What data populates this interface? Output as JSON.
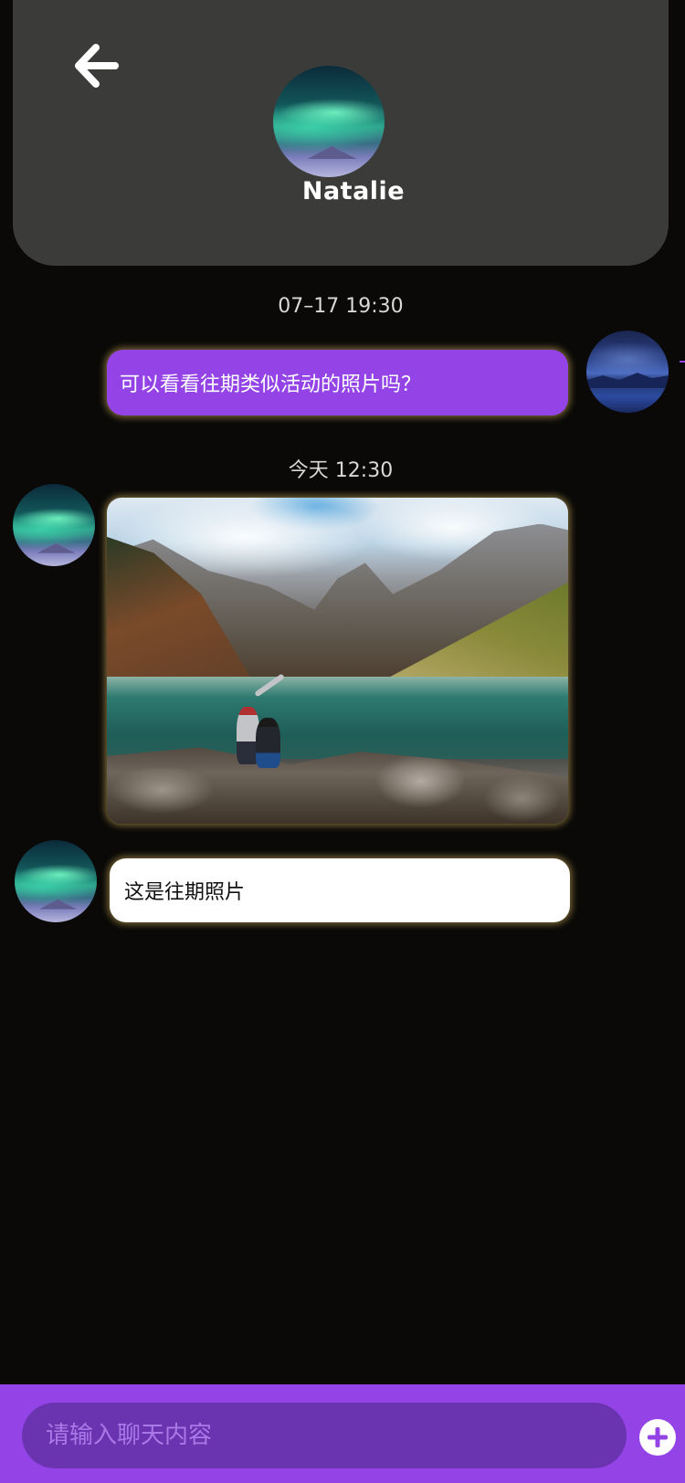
{
  "header": {
    "back_icon": "arrow-left-icon",
    "contact_name": "Natalie"
  },
  "messages": [
    {
      "timestamp": "07–17 19:30"
    },
    {
      "type": "text",
      "direction": "sent",
      "text": "可以看看往期类似活动的照片吗？"
    },
    {
      "timestamp": "今天 12:30"
    },
    {
      "type": "image",
      "direction": "received",
      "image": "mountain-lake-photo"
    },
    {
      "type": "text",
      "direction": "received",
      "text": "这是往期照片"
    }
  ],
  "composer": {
    "placeholder": "请输入聊天内容",
    "add_icon": "plus-circle-icon"
  },
  "colors": {
    "accent": "#9444e6",
    "background": "#0a0907",
    "header": "#3b3b39",
    "input_field": "#6a34b0"
  }
}
